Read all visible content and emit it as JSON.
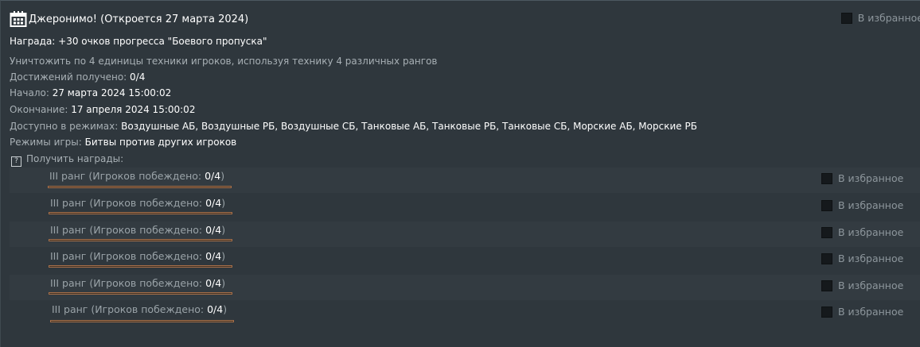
{
  "header": {
    "title": "Джеронимо! (Откроется 27 марта 2024)",
    "favorite_label": "В избранное"
  },
  "details": {
    "reward": "Награда: +30 очков прогресса \"Боевого пропуска\"",
    "task": "Уничтожить по 4 единицы техники игроков, используя технику 4 различных рангов",
    "achievements_label": "Достижений получено: ",
    "achievements_value": "0/4",
    "start_label": "Начало: ",
    "start_value": "27 марта 2024 15:00:02",
    "end_label": "Окончание: ",
    "end_value": "17 апреля 2024 15:00:02",
    "modes_label": "Доступно в режимах: ",
    "modes_value": "Воздушные АБ, Воздушные РБ, Воздушные СБ, Танковые АБ, Танковые РБ, Танковые СБ, Морские АБ, Морские РБ",
    "game_modes_label": "Режимы игры: ",
    "game_modes_value": "Битвы против других игроков",
    "get_rewards_label": "Получить награды:",
    "help_glyph": "?"
  },
  "rewards": [
    {
      "label": "III ранг (Игроков побеждено: ",
      "value": "0/4",
      "close": ")",
      "progress": 0,
      "favorite_label": "В избранное"
    },
    {
      "label": "III ранг (Игроков побеждено: ",
      "value": "0/4",
      "close": ")",
      "progress": 0,
      "favorite_label": "В избранное"
    },
    {
      "label": "III ранг (Игроков побеждено: ",
      "value": "0/4",
      "close": ")",
      "progress": 0,
      "favorite_label": "В избранное"
    },
    {
      "label": "III ранг (Игроков побеждено: ",
      "value": "0/4",
      "close": ")",
      "progress": 0,
      "favorite_label": "В избранное"
    },
    {
      "label": "III ранг (Игроков побеждено: ",
      "value": "0/4",
      "close": ")",
      "progress": 0,
      "favorite_label": "В избранное"
    },
    {
      "label": "III ранг (Игроков побеждено: ",
      "value": "0/4",
      "close": ")",
      "progress": 0,
      "favorite_label": "В избранное"
    }
  ],
  "colors": {
    "background": "#2f373d",
    "progress_border": "#a7704a",
    "checkbox": "#15191c"
  },
  "icons": {
    "header": "calendar-icon",
    "help": "help-icon"
  }
}
